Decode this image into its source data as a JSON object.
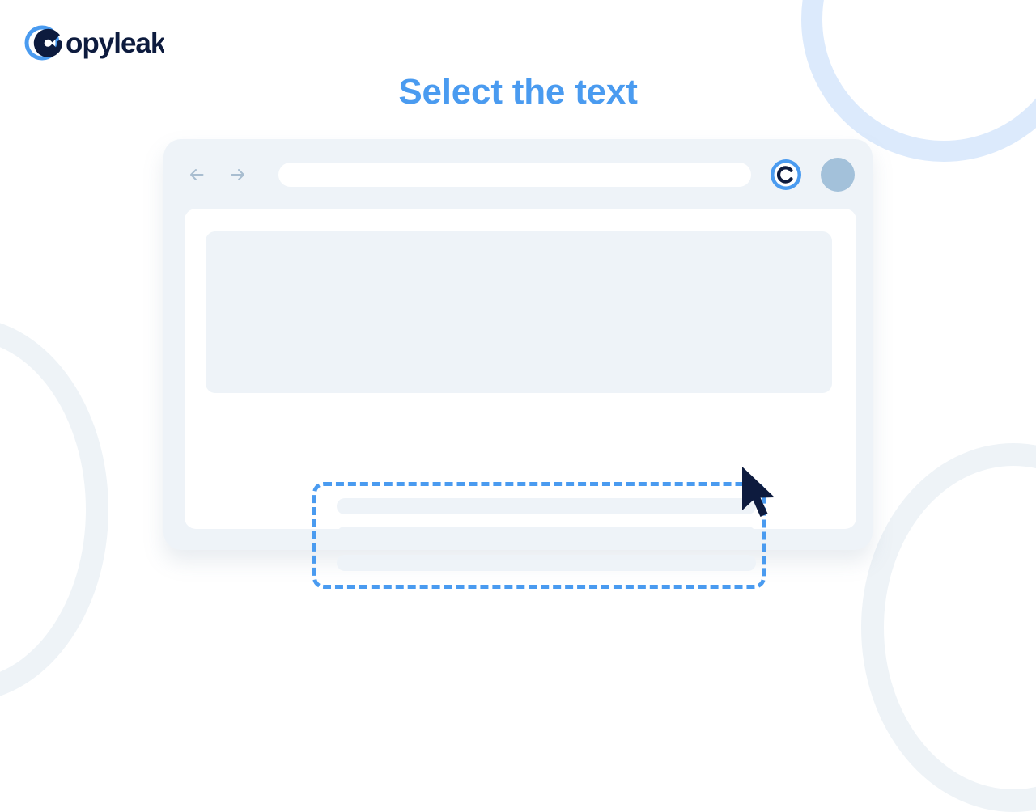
{
  "brand": {
    "logo_text": "Copyleaks",
    "logo_icon": "copyleaks-ring-icon",
    "ring_color": "#4a9bf0",
    "wordmark_color": "#0d1b3e"
  },
  "page": {
    "title": "Select the text",
    "title_color": "#4a9bf0",
    "background_color": "#ffffff"
  },
  "decorations": [
    {
      "name": "ring-top-right",
      "color": "#dceafc"
    },
    {
      "name": "ring-bottom-left",
      "color": "#eef3f7"
    },
    {
      "name": "ring-bottom-right",
      "color": "#eef3f7"
    }
  ],
  "browser": {
    "frame_color": "#eef3f8",
    "page_color": "#ffffff",
    "toolbar": {
      "back_label": "Back",
      "forward_label": "Forward",
      "back_icon": "arrow-left-icon",
      "forward_icon": "arrow-right-icon",
      "arrow_color": "#a8bdd0",
      "address_value": "",
      "address_placeholder": "",
      "extension_icon": "copyleaks-extension-icon",
      "extension_label": "Copyleaks",
      "avatar_label": "Account",
      "avatar_color": "#a3c1da"
    },
    "content": {
      "placeholder_block_label": "Content placeholder",
      "placeholder_color": "#eef3f8",
      "selection": {
        "label": "Selected text region",
        "border_color": "#4a9bf0",
        "border_style": "dashed",
        "border_width_px": 5
      },
      "text_lines": [
        {
          "label": "text-line-1"
        },
        {
          "label": "text-line-2"
        },
        {
          "label": "text-line-3"
        }
      ]
    }
  },
  "cursor": {
    "name": "mouse-pointer",
    "color": "#0d1b3e"
  }
}
